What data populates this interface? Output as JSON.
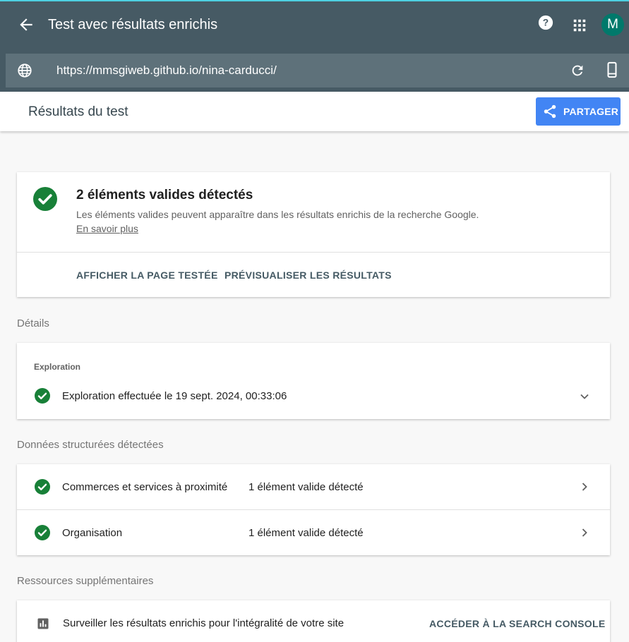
{
  "topbar": {
    "title": "Test avec résultats enrichis",
    "avatar_letter": "M",
    "url": "https://mmsgiweb.github.io/nina-carducci/"
  },
  "subheader": {
    "heading": "Résultats du test",
    "share_label": "PARTAGER"
  },
  "summary": {
    "title": "2 éléments valides détectés",
    "description": "Les éléments valides peuvent apparaître dans les résultats enrichis de la recherche Google.",
    "learn_more": "En savoir plus",
    "action_view": "AFFICHER LA PAGE TESTÉE",
    "action_preview": "PRÉVISUALISER LES RÉSULTATS"
  },
  "details": {
    "label": "Détails",
    "crawl_label": "Exploration",
    "crawl_text": "Exploration effectuée le 19 sept. 2024, 00:33:06"
  },
  "structured": {
    "label": "Données structurées détectées",
    "rows": [
      {
        "name": "Commerces et services à proximité",
        "status": "1 élément valide détecté"
      },
      {
        "name": "Organisation",
        "status": "1 élément valide détecté"
      }
    ]
  },
  "resources": {
    "label": "Ressources supplémentaires",
    "text": "Surveiller les résultats enrichis pour l'intégralité de votre site",
    "action": "ACCÉDER À LA SEARCH CONSOLE"
  },
  "colors": {
    "header": "#465a64",
    "urlbar": "#5e717a",
    "accent_blue": "#4285f4",
    "valid_green": "#188038",
    "avatar": "#00796b"
  },
  "icons": [
    "back-arrow-icon",
    "help-icon",
    "apps-grid-icon",
    "globe-icon",
    "reload-icon",
    "mobile-device-icon",
    "share-icon",
    "check-circle-icon",
    "chevron-down-icon",
    "chevron-right-icon",
    "bar-chart-icon"
  ]
}
